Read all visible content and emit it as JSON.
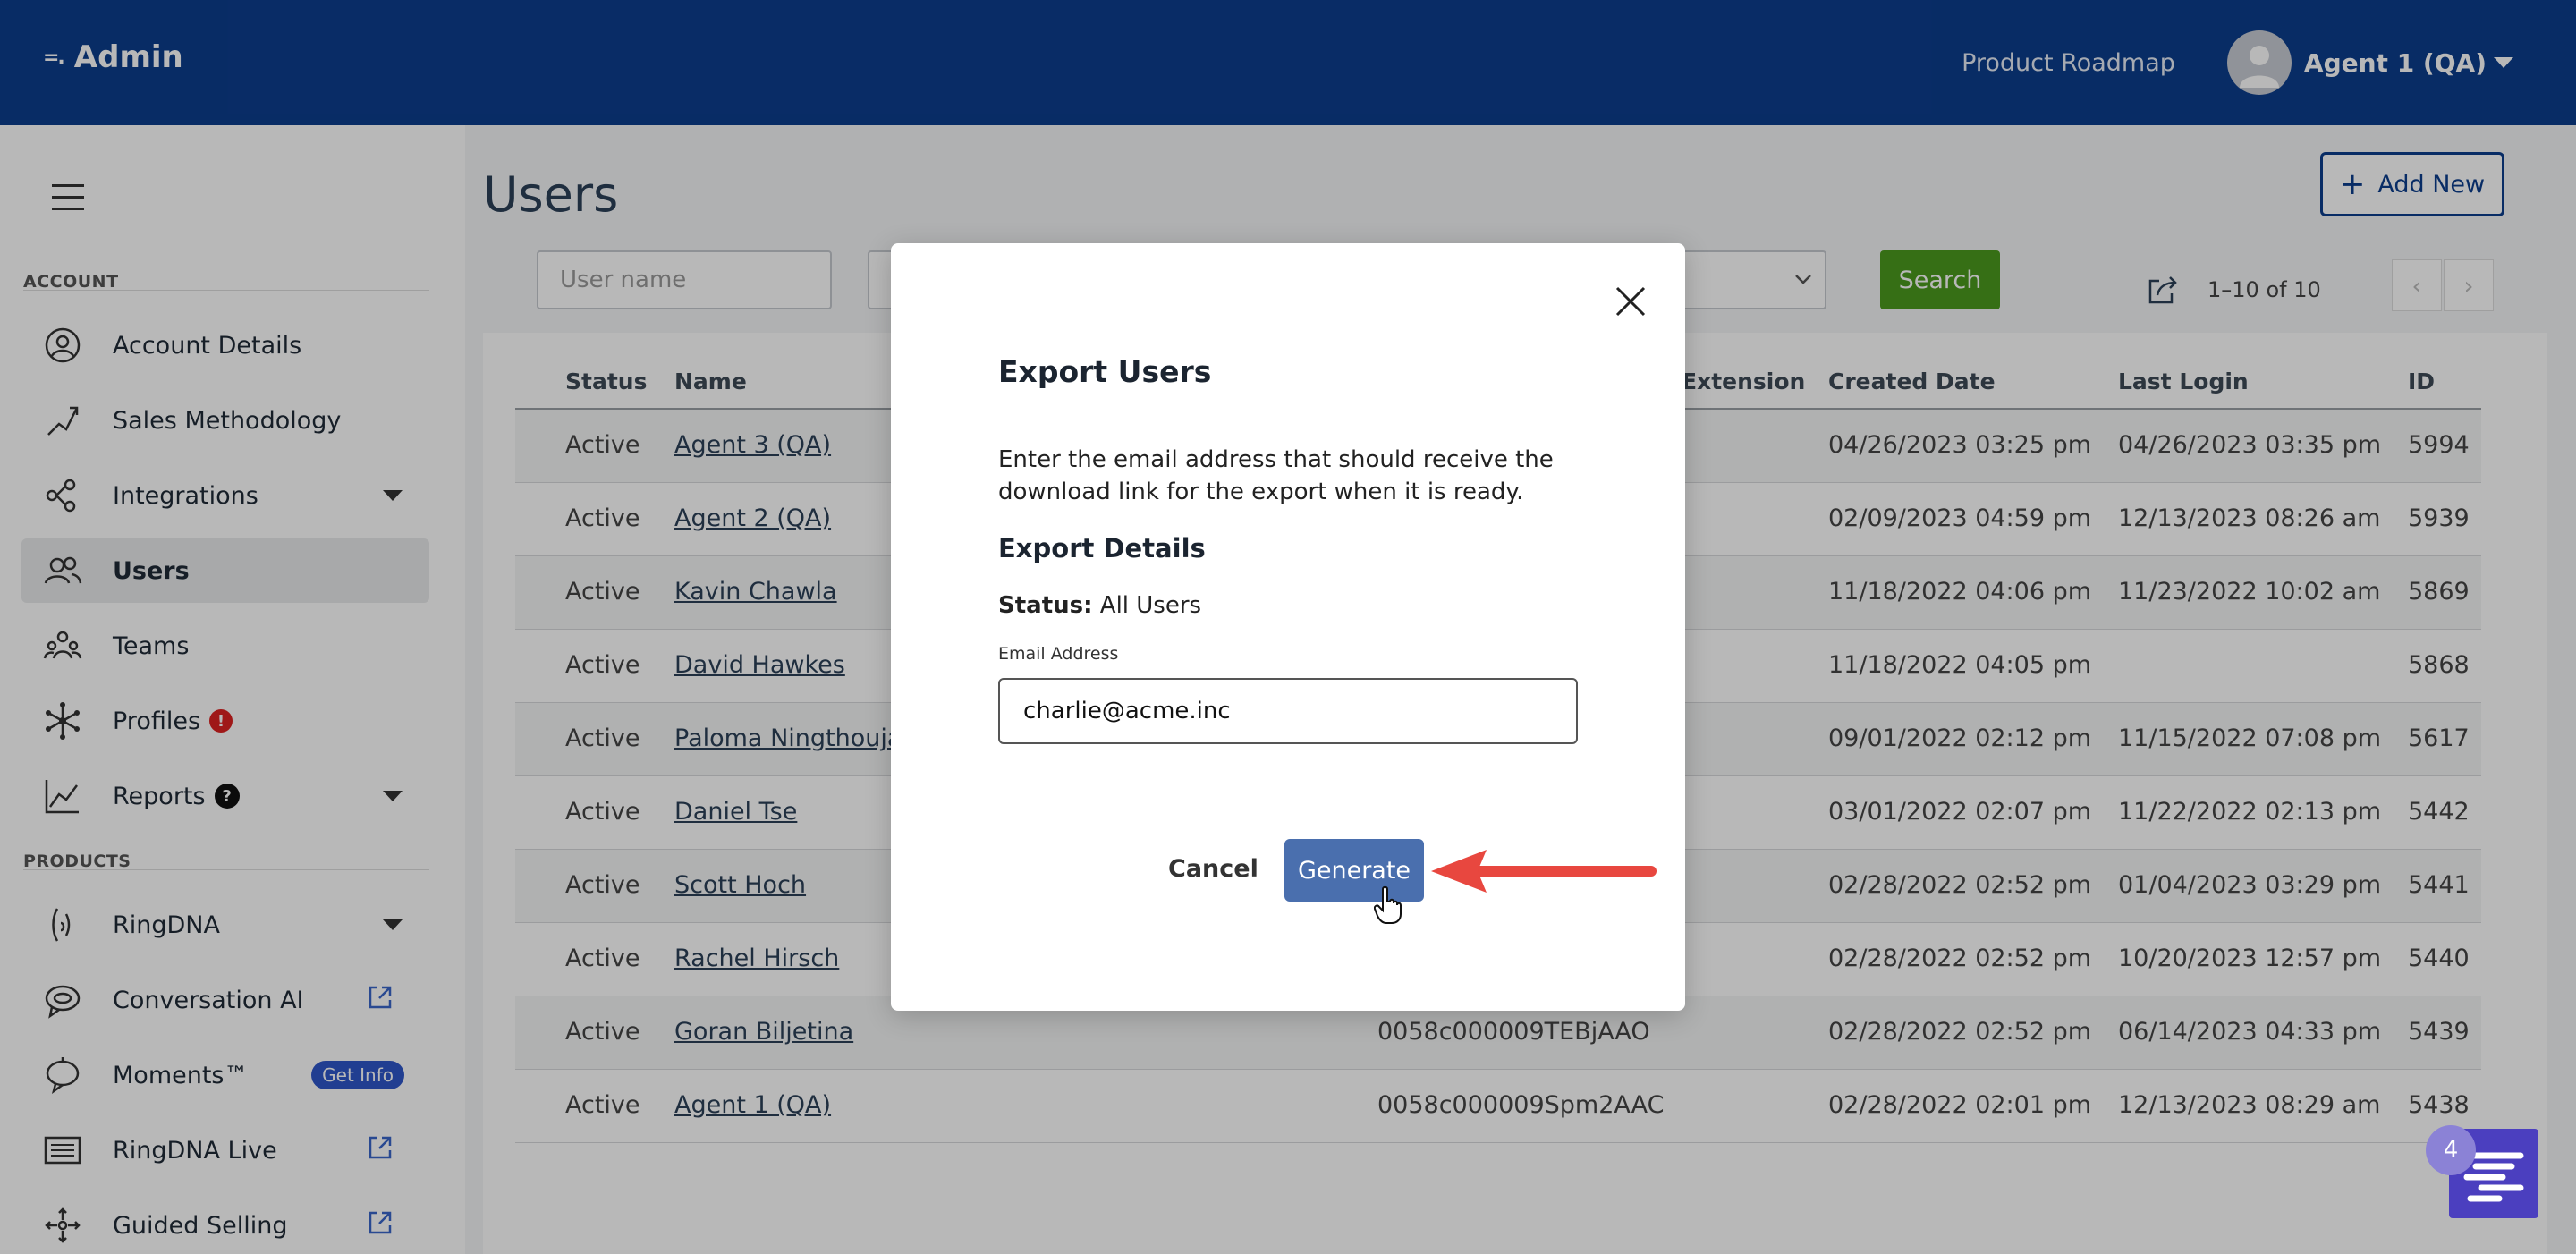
{
  "header": {
    "logo_text": "Admin",
    "product_roadmap": "Product Roadmap",
    "user_name": "Agent 1 (QA)"
  },
  "sidebar": {
    "account_label": "ACCOUNT",
    "products_label": "PRODUCTS",
    "items": [
      {
        "label": "Account Details",
        "icon": "user-circle-icon"
      },
      {
        "label": "Sales Methodology",
        "icon": "methodology-icon"
      },
      {
        "label": "Integrations",
        "icon": "integrations-icon"
      },
      {
        "label": "Users",
        "icon": "users-icon"
      },
      {
        "label": "Teams",
        "icon": "teams-icon"
      },
      {
        "label": "Profiles",
        "icon": "profiles-icon",
        "badge": "!"
      },
      {
        "label": "Reports",
        "icon": "reports-icon",
        "badge": "?"
      },
      {
        "label": "RingDNA",
        "icon": "ringdna-icon"
      },
      {
        "label": "Conversation AI",
        "icon": "conversation-ai-icon"
      },
      {
        "label": "Moments™",
        "icon": "moments-icon",
        "badge": "Get Info"
      },
      {
        "label": "RingDNA Live",
        "icon": "ringdna-live-icon"
      },
      {
        "label": "Guided Selling",
        "icon": "guided-selling-icon"
      }
    ]
  },
  "main": {
    "title": "Users",
    "add_new": "Add New",
    "username_placeholder": "User name",
    "search": "Search",
    "pager": "1–10 of 10",
    "columns": [
      "Status",
      "Name",
      "Extension",
      "Created Date",
      "Last Login",
      "ID"
    ],
    "rows": [
      {
        "status": "Active",
        "name": "Agent 3 (QA)",
        "sfid": "",
        "created": "04/26/2023 03:25 pm",
        "last_login": "04/26/2023 03:35 pm",
        "id": "5994"
      },
      {
        "status": "Active",
        "name": "Agent 2 (QA)",
        "sfid": "",
        "created": "02/09/2023 04:59 pm",
        "last_login": "12/13/2023 08:26 am",
        "id": "5939"
      },
      {
        "status": "Active",
        "name": "Kavin Chawla",
        "sfid": "",
        "created": "11/18/2022 04:06 pm",
        "last_login": "11/23/2022 10:02 am",
        "id": "5869"
      },
      {
        "status": "Active",
        "name": "David Hawkes",
        "sfid": "",
        "created": "11/18/2022 04:05 pm",
        "last_login": "",
        "id": "5868"
      },
      {
        "status": "Active",
        "name": "Paloma Ningthoujam",
        "sfid": "",
        "created": "09/01/2022 02:12 pm",
        "last_login": "11/15/2022 07:08 pm",
        "id": "5617"
      },
      {
        "status": "Active",
        "name": "Daniel Tse",
        "sfid": "",
        "created": "03/01/2022 02:07 pm",
        "last_login": "11/22/2022 02:13 pm",
        "id": "5442"
      },
      {
        "status": "Active",
        "name": "Scott Hoch",
        "sfid": "",
        "created": "02/28/2022 02:52 pm",
        "last_login": "01/04/2023 03:29 pm",
        "id": "5441"
      },
      {
        "status": "Active",
        "name": "Rachel Hirsch",
        "sfid": "",
        "created": "02/28/2022 02:52 pm",
        "last_login": "10/20/2023 12:57 pm",
        "id": "5440"
      },
      {
        "status": "Active",
        "name": "Goran Biljetina",
        "sfid": "0058c000009TEBjAAO",
        "created": "02/28/2022 02:52 pm",
        "last_login": "06/14/2023 04:33 pm",
        "id": "5439"
      },
      {
        "status": "Active",
        "name": "Agent 1 (QA)",
        "sfid": "0058c000009Spm2AAC",
        "created": "02/28/2022 02:01 pm",
        "last_login": "12/13/2023 08:29 am",
        "id": "5438"
      }
    ]
  },
  "modal": {
    "title": "Export Users",
    "description": "Enter the email address that should receive the download link for the export when it is ready.",
    "details_heading": "Export Details",
    "status_label": "Status:",
    "status_value": "All Users",
    "email_label": "Email Address",
    "email_value": "charlie@acme.inc",
    "cancel": "Cancel",
    "generate": "Generate"
  },
  "help_widget": {
    "count": "4"
  }
}
